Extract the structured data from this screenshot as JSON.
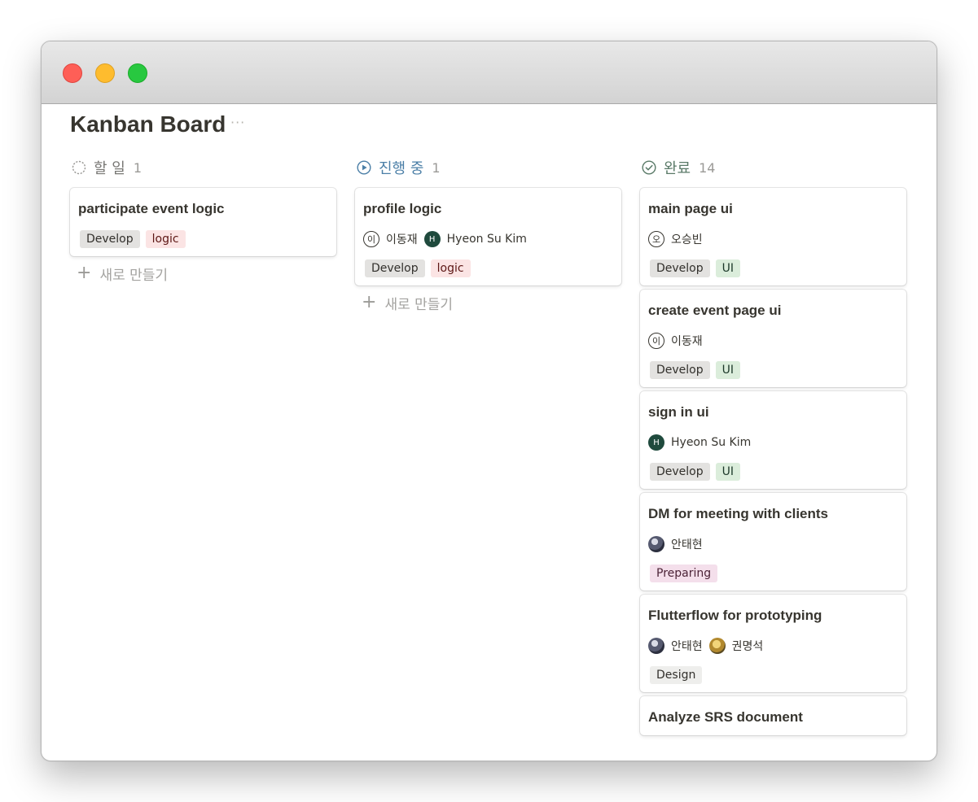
{
  "page": {
    "title": "Kanban Board",
    "more": "···"
  },
  "colors": {
    "todo": "#787774",
    "in_progress": "#4b7fa7",
    "done": "#5a7a68"
  },
  "columns": [
    {
      "label": "할 일",
      "count": "1",
      "status_icon": "circle-dashed-icon",
      "new_label": "새로 만들기",
      "cards": [
        {
          "title": "participate event logic",
          "people": [],
          "tags": [
            {
              "label": "Develop"
            },
            {
              "label": "logic"
            }
          ]
        }
      ]
    },
    {
      "label": "진행 중",
      "count": "1",
      "status_icon": "play-circle-icon",
      "new_label": "새로 만들기",
      "cards": [
        {
          "title": "profile logic",
          "people": [
            {
              "initial": "이",
              "name": "이동재"
            },
            {
              "initial": "H",
              "name": "Hyeon Su Kim"
            }
          ],
          "tags": [
            {
              "label": "Develop"
            },
            {
              "label": "logic"
            }
          ]
        }
      ]
    },
    {
      "label": "완료",
      "count": "14",
      "status_icon": "check-circle-icon",
      "cards": [
        {
          "title": "main page ui",
          "people": [
            {
              "initial": "오",
              "name": "오승빈"
            }
          ],
          "tags": [
            {
              "label": "Develop"
            },
            {
              "label": "UI"
            }
          ]
        },
        {
          "title": "create event page ui",
          "people": [
            {
              "initial": "이",
              "name": "이동재"
            }
          ],
          "tags": [
            {
              "label": "Develop"
            },
            {
              "label": "UI"
            }
          ]
        },
        {
          "title": "sign in ui",
          "people": [
            {
              "initial": "H",
              "name": "Hyeon Su Kim"
            }
          ],
          "tags": [
            {
              "label": "Develop"
            },
            {
              "label": "UI"
            }
          ]
        },
        {
          "title": "DM for meeting with clients",
          "people": [
            {
              "name": "안태현"
            }
          ],
          "tags": [
            {
              "label": "Preparing"
            }
          ]
        },
        {
          "title": "Flutterflow for prototyping",
          "people": [
            {
              "name": "안태현"
            },
            {
              "name": "권명석"
            }
          ],
          "tags": [
            {
              "label": "Design"
            }
          ]
        },
        {
          "title": "Analyze SRS document"
        }
      ]
    }
  ]
}
